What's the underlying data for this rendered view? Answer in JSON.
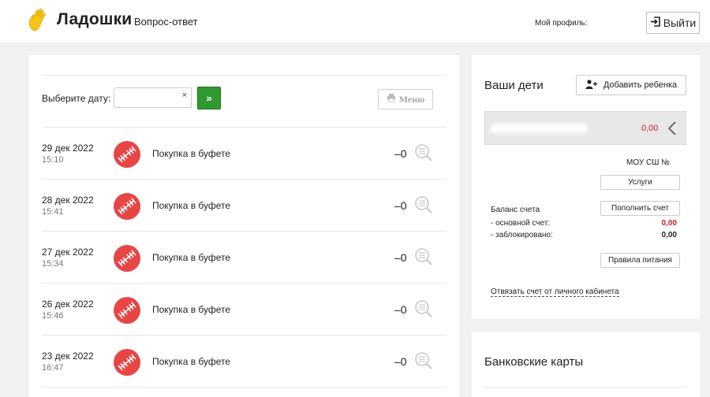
{
  "header": {
    "logo_text": "Ладошки",
    "nav_qa": "Вопрос-ответ",
    "profile_label": "Мой профиль:",
    "logout_label": "Выйти"
  },
  "filter": {
    "date_label": "Выберите дату:",
    "date_value": "",
    "clear_glyph": "×",
    "go_label": "»",
    "menu_label": "Меню"
  },
  "transactions": [
    {
      "date": "29 дек 2022",
      "time": "15:10",
      "desc": "Покупка в буфете",
      "amount": "–0"
    },
    {
      "date": "28 дек 2022",
      "time": "15:41",
      "desc": "Покупка в буфете",
      "amount": "–0"
    },
    {
      "date": "27 дек 2022",
      "time": "15:34",
      "desc": "Покупка в буфете",
      "amount": "–0"
    },
    {
      "date": "26 дек 2022",
      "time": "15:46",
      "desc": "Покупка в буфете",
      "amount": "–0"
    },
    {
      "date": "23 дек 2022",
      "time": "16:47",
      "desc": "Покупка в буфете",
      "amount": "–0"
    }
  ],
  "children": {
    "title": "Ваши дети",
    "add_label": "Добавить ребенка",
    "child_balance": "0,00",
    "school": "МОУ СШ №",
    "services_label": "Услуги",
    "balance_label": "Баланс счета",
    "topup_label": "Пополнить счет",
    "main_label": "- основной счет:",
    "main_value": "0,00",
    "blocked_label": "- заблокировано:",
    "blocked_value": "0,00",
    "rules_label": "Правила питания",
    "unlink_label": "Отвязать счет от личного кабинета"
  },
  "bank": {
    "title": "Банковские карты"
  },
  "colors": {
    "logo_yellow": "#f5c518",
    "go_green": "#2f9a2f",
    "category_red": "#e84545",
    "negative_red": "#d02020"
  },
  "icons": {
    "logo": "hand-icon",
    "logout": "exit-icon",
    "menu": "printer-icon",
    "category": "cutlery-icon",
    "detail": "search-receipt-icon",
    "add_child": "add-user-icon",
    "child_toggle": "chevron-left-icon"
  }
}
